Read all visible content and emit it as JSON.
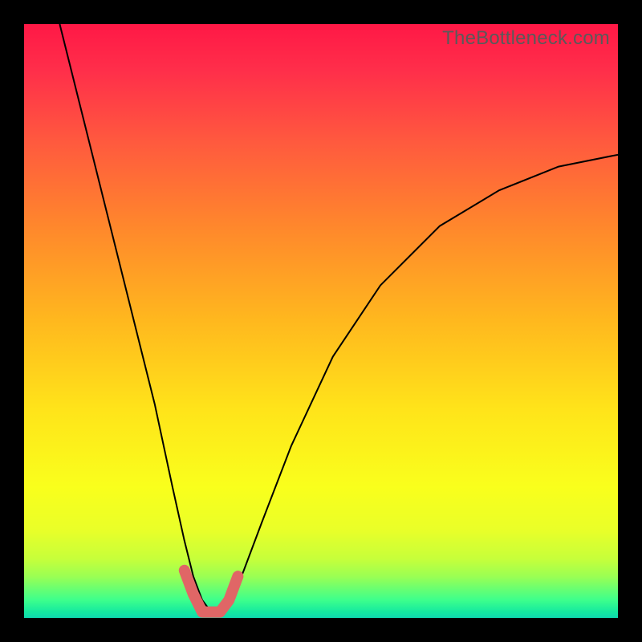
{
  "watermark": "TheBottleneck.com",
  "colors": {
    "frame": "#000000",
    "gradient_top": "#ff1846",
    "gradient_bottom": "#0fd9b0",
    "curve": "#000000",
    "marker": "#e06666"
  },
  "chart_data": {
    "type": "line",
    "title": "",
    "xlabel": "",
    "ylabel": "",
    "xlim": [
      0,
      100
    ],
    "ylim": [
      0,
      100
    ],
    "grid": false,
    "legend": false,
    "series": [
      {
        "name": "bottleneck-curve",
        "x": [
          6,
          10,
          14,
          18,
          22,
          25,
          27,
          28.5,
          30,
          31.5,
          33,
          35,
          37,
          40,
          45,
          52,
          60,
          70,
          80,
          90,
          100
        ],
        "y": [
          100,
          84,
          68,
          52,
          36,
          22,
          13,
          7,
          3,
          1,
          1,
          3,
          8,
          16,
          29,
          44,
          56,
          66,
          72,
          76,
          78
        ]
      }
    ],
    "markers": {
      "name": "highlight-band",
      "x": [
        27,
        28.5,
        30,
        31.5,
        33,
        34.5,
        36
      ],
      "y": [
        8,
        4,
        1,
        1,
        1,
        3,
        7
      ]
    }
  }
}
